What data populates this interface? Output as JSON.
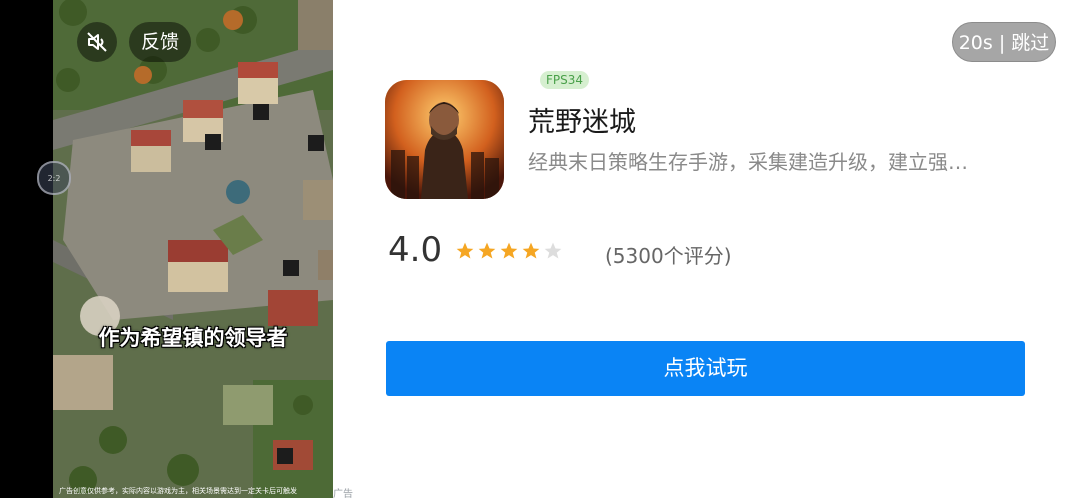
{
  "video": {
    "feedback_label": "反馈",
    "subtitle": "作为希望镇的领导者",
    "disclaimer": "广告创意仅供参考，实际内容以游戏为主，相关场景需达到一定关卡后可触发",
    "side_ring_text": "2:2",
    "mute_icon": "muted-speaker-icon"
  },
  "ad_label": "广告",
  "skip": {
    "label": "20s | 跳过"
  },
  "app": {
    "fps_badge": "FPS34",
    "title": "荒野迷城",
    "description": "经典末日策略生存手游，采集建造升级，建立强…",
    "rating": "4.0",
    "rating_value": 4.0,
    "rating_max": 5,
    "rating_count": "(5300个评分)"
  },
  "cta": {
    "label": "点我试玩"
  },
  "colors": {
    "accent": "#0a84f5",
    "star_filled": "#f5a623",
    "star_empty": "#dddddd",
    "fps_badge_bg": "#d6efd0",
    "fps_badge_text": "#4aa04a"
  }
}
